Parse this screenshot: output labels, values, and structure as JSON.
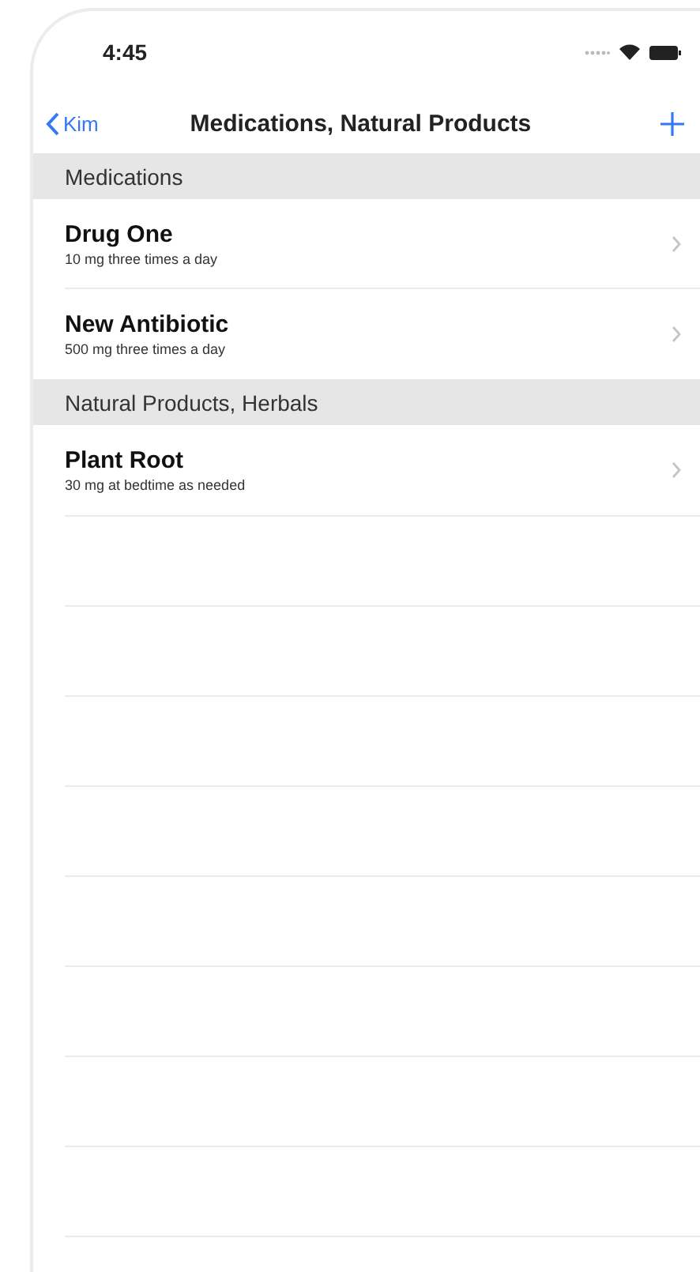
{
  "status_bar": {
    "time": "4:45"
  },
  "nav_bar": {
    "back": "Kim",
    "title": "Medications, Natural Products"
  },
  "sections": [
    {
      "header": "Medications",
      "items": [
        {
          "name": "Drug One",
          "detail": "10 mg three times a day"
        },
        {
          "name": "New Antibiotic",
          "detail": "500 mg three times a day"
        }
      ]
    },
    {
      "header": "Natural Products, Herbals",
      "items": [
        {
          "name": "Plant Root",
          "detail": "30 mg at bedtime as needed"
        }
      ]
    }
  ]
}
